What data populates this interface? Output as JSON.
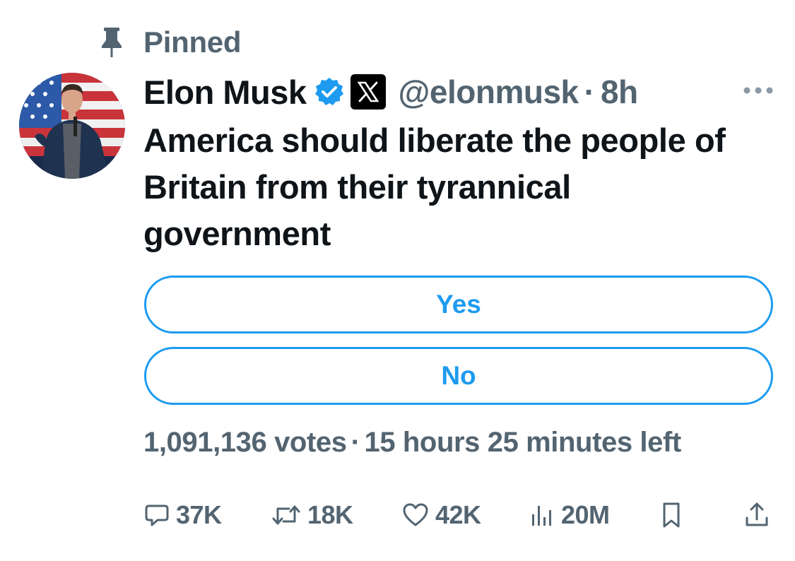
{
  "pinned": {
    "label": "Pinned",
    "icon": "pin-icon"
  },
  "author": {
    "display_name": "Elon Musk",
    "verified_icon": "verified-badge-icon",
    "affiliation_icon": "x-logo-icon",
    "handle": "@elonmusk",
    "separator": "·",
    "time": "8h",
    "more_icon": "more-horizontal-icon"
  },
  "tweet": {
    "text": "America should liberate the people of Britain from their tyrannical government"
  },
  "poll": {
    "options": [
      {
        "label": "Yes"
      },
      {
        "label": "No"
      }
    ],
    "votes": "1,091,136 votes",
    "separator": "·",
    "time_left": "15 hours 25 minutes left"
  },
  "actions": {
    "reply": {
      "icon": "reply-icon",
      "count": "37K"
    },
    "retweet": {
      "icon": "retweet-icon",
      "count": "18K"
    },
    "like": {
      "icon": "heart-icon",
      "count": "42K"
    },
    "views": {
      "icon": "views-icon",
      "count": "20M"
    },
    "bookmark": {
      "icon": "bookmark-icon"
    },
    "share": {
      "icon": "share-icon"
    }
  },
  "colors": {
    "accent": "#1d9bf0",
    "text_primary": "#0f1419",
    "text_secondary": "#536471",
    "background": "#ffffff"
  }
}
